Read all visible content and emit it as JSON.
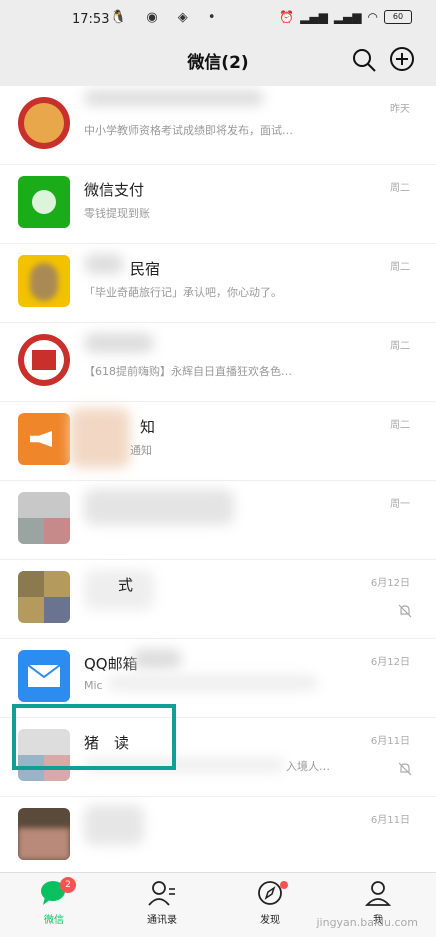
{
  "status_bar": {
    "time": "17:53",
    "left_icons": "🐧 ◉ ◈ •",
    "battery": "60"
  },
  "header": {
    "title": "微信(2)"
  },
  "chats": [
    {
      "name": "",
      "preview": "中小学教师资格考试成绩即将发布，面试…",
      "time": "昨天"
    },
    {
      "name": "微信支付",
      "preview": "零钱提现到账",
      "time": "周二"
    },
    {
      "name": "民宿",
      "preview": "「毕业奇葩旅行记」承认吧，你心动了。",
      "time": "周二"
    },
    {
      "name": "",
      "preview": "【618提前嗨购】永辉自日直播狂欢各色…",
      "time": "周二"
    },
    {
      "name": "知",
      "preview": "通知",
      "time": "周二"
    },
    {
      "name": "",
      "preview": "",
      "time": "周一"
    },
    {
      "name": "式",
      "preview": "",
      "time": "6月12日"
    },
    {
      "name": "QQ邮箱",
      "preview": "Mic",
      "time": "6月12日"
    },
    {
      "name": "猪　读",
      "preview": "入境人…",
      "time": "6月11日"
    },
    {
      "name": "",
      "preview": "",
      "time": "6月11日"
    }
  ],
  "tabs": [
    {
      "label": "微信",
      "badge": "2"
    },
    {
      "label": "通讯录"
    },
    {
      "label": "发现"
    },
    {
      "label": "我"
    }
  ],
  "watermark": "jingyan.baidu.com",
  "colors": {
    "accent": "#07c160",
    "badge": "#fa5151",
    "highlight": "#0f9f95"
  }
}
